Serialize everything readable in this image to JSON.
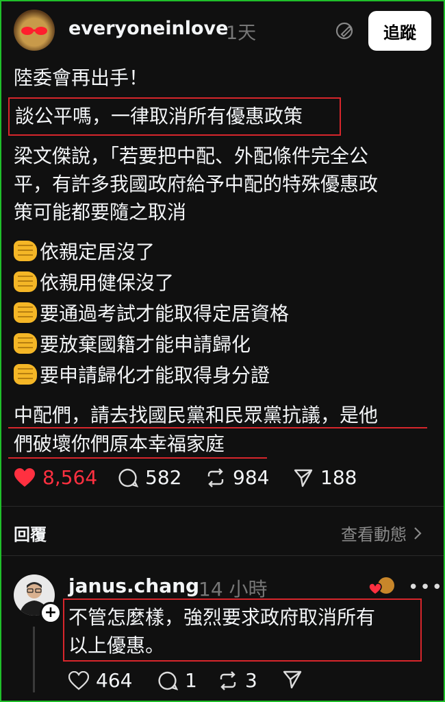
{
  "post": {
    "username": "everyoneinlove",
    "time": "1天",
    "follow_label": "追蹤",
    "line1": "陸委會再出手！",
    "line2": "談公平嗎，一律取消所有優惠政策",
    "para1": [
      "梁文傑說，「若要把中配、外配條件完全公",
      "平，有許多我國政府給予中配的特殊優惠政",
      "策可能都要隨之取消"
    ],
    "bullets": [
      "依親定居沒了",
      "依親用健保沒了",
      "要通過考試才能取得定居資格",
      "要放棄國籍才能申請歸化",
      "要申請歸化才能取得身分證"
    ],
    "closing": [
      "中配們，請去找國民黨和民眾黨抗議，是他",
      "們破壞你們原本幸福家庭"
    ],
    "stats": {
      "likes": "8,564",
      "replies": "582",
      "reposts": "984",
      "shares": "188"
    },
    "colors": {
      "accent_like": "#ff3040",
      "highlight_border": "#d8262c"
    }
  },
  "replies_section": {
    "label": "回覆",
    "activity_label": "查看動態"
  },
  "reply": {
    "username": "janus.chang",
    "time": "14 小時",
    "text": [
      "不管怎麼樣，強烈要求政府取消所有",
      "以上優惠。"
    ],
    "stats": {
      "likes": "464",
      "replies": "1",
      "reposts": "3"
    }
  },
  "icons": [
    "edit-icon",
    "heart-icon",
    "comment-icon",
    "repost-icon",
    "share-icon",
    "chevron-right-icon",
    "plus-icon",
    "more-icon",
    "fist-icon"
  ]
}
